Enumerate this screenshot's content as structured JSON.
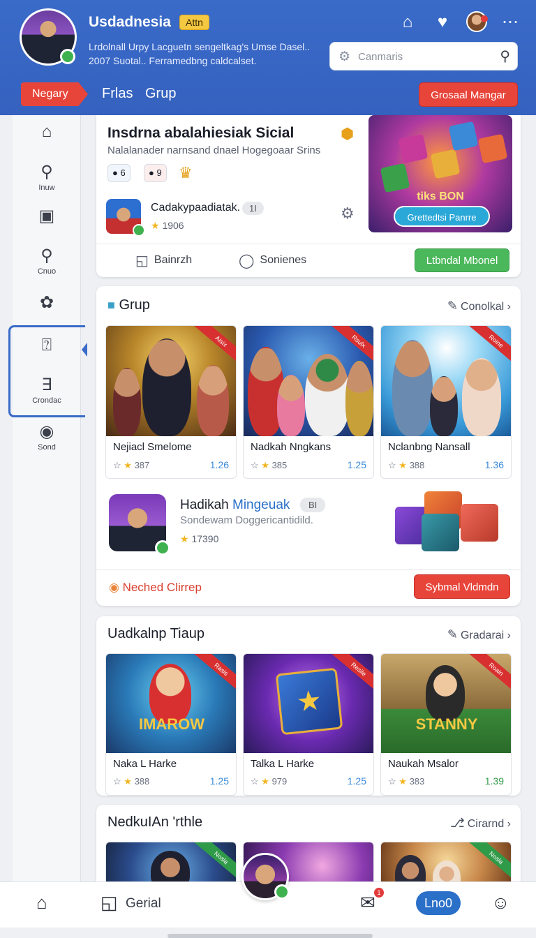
{
  "header": {
    "app_title": "Usdadnesia",
    "badge": "Attn",
    "subtitle": "Lrdolnall Urpy Lacguetn sengeltkag's Umse Dasel.. 2007 Suotal.. Ferramedbng caldcalset.",
    "search_placeholder": "Canmaris",
    "nav_pill": "Negary",
    "tabs": [
      "Frlas",
      "Grup"
    ],
    "action_button": "Grosaal Mangar"
  },
  "sidebar": {
    "items": [
      {
        "icon": "home-icon",
        "label": ""
      },
      {
        "icon": "user-icon",
        "label": "Inuw"
      },
      {
        "icon": "grid-icon",
        "label": ""
      },
      {
        "icon": "search-icon",
        "label": "Cnuo"
      },
      {
        "icon": "chat-icon",
        "label": ""
      },
      {
        "icon": "question-icon",
        "label": ""
      },
      {
        "icon": "briefcase-icon",
        "label": "Crondac"
      },
      {
        "icon": "dot-icon",
        "label": "Sond"
      }
    ]
  },
  "featured": {
    "title": "Insdrna abalahiesiak Sicial",
    "subtitle": "Nalalanader narnsand dnael Hogegoaar Srins",
    "chips": [
      "6",
      "9"
    ],
    "user_name": "Cadakypaadiatak.",
    "user_tag": "1I",
    "user_score": "1906",
    "banner_title": "tiks BON",
    "banner_button": "Grettedtsi Panrre",
    "actions": [
      "Bainrzh",
      "Sonienes"
    ],
    "green_button": "Ltbndal Mbonel"
  },
  "grup": {
    "title": "Grup",
    "link": "Conolkal",
    "tiles": [
      {
        "name": "Nejiacl Smelome",
        "count": "387",
        "value": "1.26",
        "ribbon": "Aisix"
      },
      {
        "name": "Nadkah Nngkans",
        "count": "385",
        "value": "1.25",
        "ribbon": "Rsulx"
      },
      {
        "name": "Nclanbng Nansall",
        "count": "388",
        "value": "1.36",
        "ribbon": "Roine"
      }
    ],
    "user_name_a": "Hadikah",
    "user_name_b": "Mingeuak",
    "user_tag": "BI",
    "user_sub": "Sondewam Doggericantidild.",
    "user_score": "17390",
    "footer_link": "Neched Clirrep",
    "red_button": "Sybmal Vldmdn"
  },
  "uadkalnp": {
    "title": "Uadkalnp Tiaup",
    "link": "Gradarai",
    "tiles": [
      {
        "name": "Naka L Harke",
        "count": "388",
        "value": "1.25",
        "ribbon": "Rasis",
        "art": "IMAROW"
      },
      {
        "name": "Talka L Harke",
        "count": "979",
        "value": "1.25",
        "ribbon": "Resile",
        "art": ""
      },
      {
        "name": "Naukah Msalor",
        "count": "383",
        "value": "1.39",
        "ribbon": "Roain",
        "art": "STANNY"
      }
    ]
  },
  "nedkulan": {
    "title": "NedkuIAn 'rthle",
    "link": "Cirarnd",
    "ribbons": [
      "Nosla",
      "",
      "Nosla"
    ]
  },
  "bottom_nav": {
    "label": "Gerial",
    "pill": "Lno0",
    "badge": "1"
  },
  "colors": {
    "header_blue": "#3a6bc8",
    "accent_red": "#e8453a",
    "accent_green": "#4cb85c",
    "value_blue": "#3a8ad8"
  }
}
